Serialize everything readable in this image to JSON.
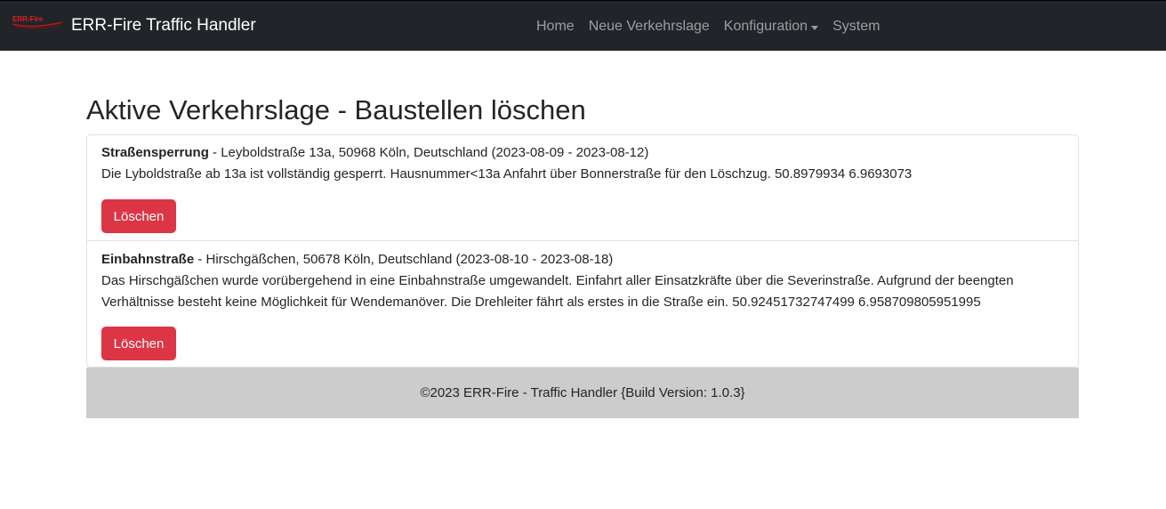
{
  "navbar": {
    "logo_text": "ERR-Fire",
    "brand_title": "ERR-Fire Traffic Handler",
    "links": {
      "home": "Home",
      "new_situation": "Neue Verkehrslage",
      "configuration": "Konfiguration",
      "system": "System"
    }
  },
  "page": {
    "title": "Aktive Verkehrslage - Baustellen löschen"
  },
  "items": [
    {
      "type": "Straßensperrung",
      "details": " - Leyboldstraße 13a, 50968 Köln, Deutschland (2023-08-09 - 2023-08-12)",
      "description": "Die Lyboldstraße ab 13a ist vollständig gesperrt. Hausnummer<13a Anfahrt über Bonnerstraße für den Löschzug. 50.8979934 6.9693073",
      "delete_label": "Löschen"
    },
    {
      "type": "Einbahnstraße",
      "details": " - Hirschgäßchen, 50678 Köln, Deutschland (2023-08-10 - 2023-08-18)",
      "description": "Das Hirschgäßchen wurde vorübergehend in eine Einbahnstraße umgewandelt. Einfahrt aller Einsatzkräfte über die Severinstraße. Aufgrund der beengten Verhältnisse besteht keine Möglichkeit für Wendemanöver. Die Drehleiter fährt als erstes in die Straße ein. 50.92451732747499 6.958709805951995",
      "delete_label": "Löschen"
    }
  ],
  "footer": {
    "text": "©2023 ERR-Fire - Traffic Handler {Build Version: 1.0.3}"
  },
  "colors": {
    "navbar_bg": "#212529",
    "danger": "#dc3545",
    "footer_bg": "#cccccc"
  }
}
